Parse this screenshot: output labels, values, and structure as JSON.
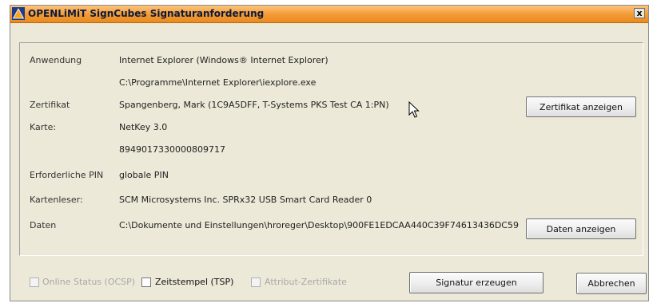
{
  "window": {
    "title": "OPENLiMiT SignCubes Signaturanforderung",
    "close_glyph": "x",
    "app_icon": "warning-triangle-icon"
  },
  "details": {
    "anwendung_label": "Anwendung",
    "anwendung_value": "Internet Explorer (Windows® Internet Explorer)",
    "anwendung_path": "C:\\Programme\\Internet Explorer\\iexplore.exe",
    "zertifikat_label": "Zertifikat",
    "zertifikat_value": "Spangenberg, Mark (1C9A5DFF, T-Systems PKS Test CA 1:PN)",
    "karte_label": "Karte:",
    "karte_value": "NetKey 3.0",
    "karte_number": "8949017330000809717",
    "pin_label": "Erforderliche PIN",
    "pin_value": "globale PIN",
    "leser_label": "Kartenleser:",
    "leser_value": "SCM Microsystems Inc. SPRx32 USB Smart Card Reader 0",
    "daten_label": "Daten",
    "daten_value": "C:\\Dokumente und Einstellungen\\hroreger\\Desktop\\900FE1EDCAA440C39F74613436DC59"
  },
  "buttons": {
    "zertifikat_anzeigen": "Zertifikat anzeigen",
    "daten_anzeigen": "Daten anzeigen",
    "signatur_erzeugen": "Signatur erzeugen",
    "abbrechen": "Abbrechen"
  },
  "options": {
    "ocsp": {
      "label": "Online Status (OCSP)",
      "checked": false,
      "enabled": false
    },
    "tsp": {
      "label": "Zeitstempel (TSP)",
      "checked": false,
      "enabled": true
    },
    "attribut": {
      "label": "Attribut-Zertifikate",
      "checked": false,
      "enabled": false
    }
  },
  "colors": {
    "titlebar": "#f39c38",
    "dialog_background": "#ece9d8"
  }
}
